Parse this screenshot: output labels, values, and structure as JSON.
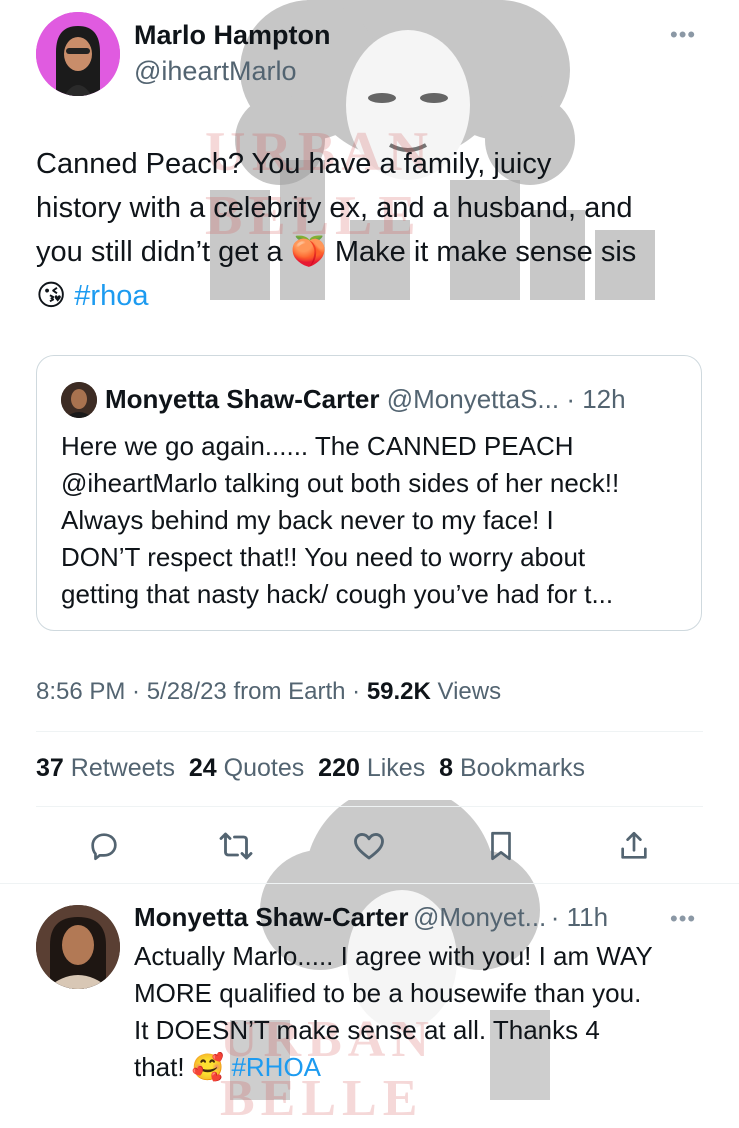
{
  "tweet": {
    "author_name": "Marlo Hampton",
    "author_handle": "@iheartMarlo",
    "more_label": "•••",
    "text_lines": [
      "Canned Peach? You have a family, juicy",
      "history with a celebrity ex, and a husband, and",
      "you still didn’t get a",
      "Make it make sense sis"
    ],
    "peach_emoji": "🍑",
    "kiss_emoji": "😘",
    "hashtag": "#rhoa",
    "timestamp": "8:56 PM · 5/28/23 from Earth · ",
    "views_count": "59.2K",
    "views_label": " Views"
  },
  "quoted": {
    "author_name": "Monyetta Shaw-Carter",
    "author_handle": "@MonyettaS...",
    "time": "· 12h",
    "text_lines": [
      "Here we go again...... The CANNED PEACH",
      "@iheartMarlo talking out both sides of her neck!!",
      "Always behind my back never to my face! I",
      "DON’T respect that!! You need to worry about",
      "getting that nasty hack/ cough you’ve had for t..."
    ]
  },
  "stats": {
    "retweets_count": "37",
    "retweets_label": "Retweets",
    "quotes_count": "24",
    "quotes_label": "Quotes",
    "likes_count": "220",
    "likes_label": "Likes",
    "bookmarks_count": "8",
    "bookmarks_label": "Bookmarks"
  },
  "actions": [
    "reply-icon",
    "retweet-icon",
    "like-icon",
    "bookmark-icon",
    "share-icon"
  ],
  "reply": {
    "author_name": "Monyetta Shaw-Carter",
    "author_handle": "@Monyet...",
    "time": "· 11h",
    "more_label": "•••",
    "text_lines": [
      "Actually Marlo..... I agree with you! I am WAY",
      "MORE qualified to be a housewife than you.",
      "It DOESN’T make sense at all. Thanks 4",
      "that!"
    ],
    "emoji": "🥰",
    "hashtag": "#RHOA"
  },
  "watermark": {
    "text": "URBAN BELLE"
  },
  "colors": {
    "link": "#1d9bf0",
    "muted": "#536471",
    "border": "#cfd9de"
  }
}
